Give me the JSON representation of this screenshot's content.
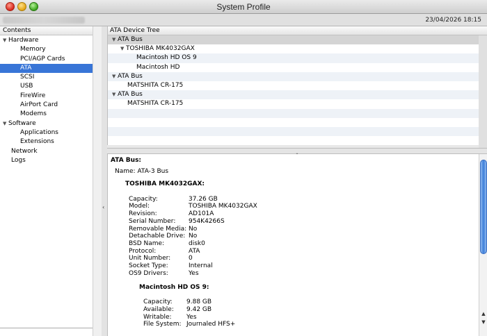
{
  "window": {
    "title": "System Profile"
  },
  "toolbar": {
    "datetime": "23/04/2026 18:15"
  },
  "sidebar": {
    "header": "Contents",
    "items": [
      {
        "label": "Hardware",
        "level": 0,
        "expanded": true
      },
      {
        "label": "Memory",
        "level": 1
      },
      {
        "label": "PCI/AGP Cards",
        "level": 1
      },
      {
        "label": "ATA",
        "level": 1,
        "selected": true
      },
      {
        "label": "SCSI",
        "level": 1
      },
      {
        "label": "USB",
        "level": 1
      },
      {
        "label": "FireWire",
        "level": 1
      },
      {
        "label": "AirPort Card",
        "level": 1
      },
      {
        "label": "Modems",
        "level": 1
      },
      {
        "label": "Software",
        "level": 0,
        "expanded": true
      },
      {
        "label": "Applications",
        "level": 1
      },
      {
        "label": "Extensions",
        "level": 1
      },
      {
        "label": "Network",
        "level": 0
      },
      {
        "label": "Logs",
        "level": 0
      }
    ]
  },
  "tree": {
    "header": "ATA Device Tree",
    "rows": [
      {
        "label": "ATA Bus",
        "level": 0,
        "expanded": true,
        "selected": true
      },
      {
        "label": "TOSHIBA MK4032GAX",
        "level": 1,
        "expanded": true
      },
      {
        "label": "Macintosh HD OS 9",
        "level": 2
      },
      {
        "label": "Macintosh HD",
        "level": 2
      },
      {
        "label": "ATA Bus",
        "level": 0,
        "expanded": true
      },
      {
        "label": "MATSHITA CR-175",
        "level": 1
      },
      {
        "label": "ATA Bus",
        "level": 0,
        "expanded": true
      },
      {
        "label": "MATSHITA CR-175",
        "level": 1
      },
      {
        "label": "",
        "level": 0
      },
      {
        "label": "",
        "level": 0
      },
      {
        "label": "",
        "level": 0
      },
      {
        "label": "",
        "level": 0
      }
    ]
  },
  "detail": {
    "title": "ATA Bus:",
    "name_line": "Name:  ATA-3 Bus",
    "device_title": "TOSHIBA MK4032GAX:",
    "device_fields": [
      {
        "key": "Capacity:",
        "value": "37.26 GB"
      },
      {
        "key": "Model:",
        "value": "TOSHIBA MK4032GAX"
      },
      {
        "key": "Revision:",
        "value": "AD101A"
      },
      {
        "key": "Serial Number:",
        "value": "954K4266S"
      },
      {
        "key": "Removable Media:",
        "value": "No"
      },
      {
        "key": "Detachable Drive:",
        "value": "No"
      },
      {
        "key": "BSD Name:",
        "value": "disk0"
      },
      {
        "key": "Protocol:",
        "value": "ATA"
      },
      {
        "key": "Unit Number:",
        "value": "0"
      },
      {
        "key": "Socket Type:",
        "value": "Internal"
      },
      {
        "key": "OS9 Drivers:",
        "value": "Yes"
      }
    ],
    "volume_title": "Macintosh HD OS 9:",
    "volume_fields": [
      {
        "key": "Capacity:",
        "value": "9.88 GB"
      },
      {
        "key": "Available:",
        "value": "9.42 GB"
      },
      {
        "key": "Writable:",
        "value": "Yes"
      },
      {
        "key": "File System:",
        "value": "Journaled HFS+"
      }
    ]
  }
}
